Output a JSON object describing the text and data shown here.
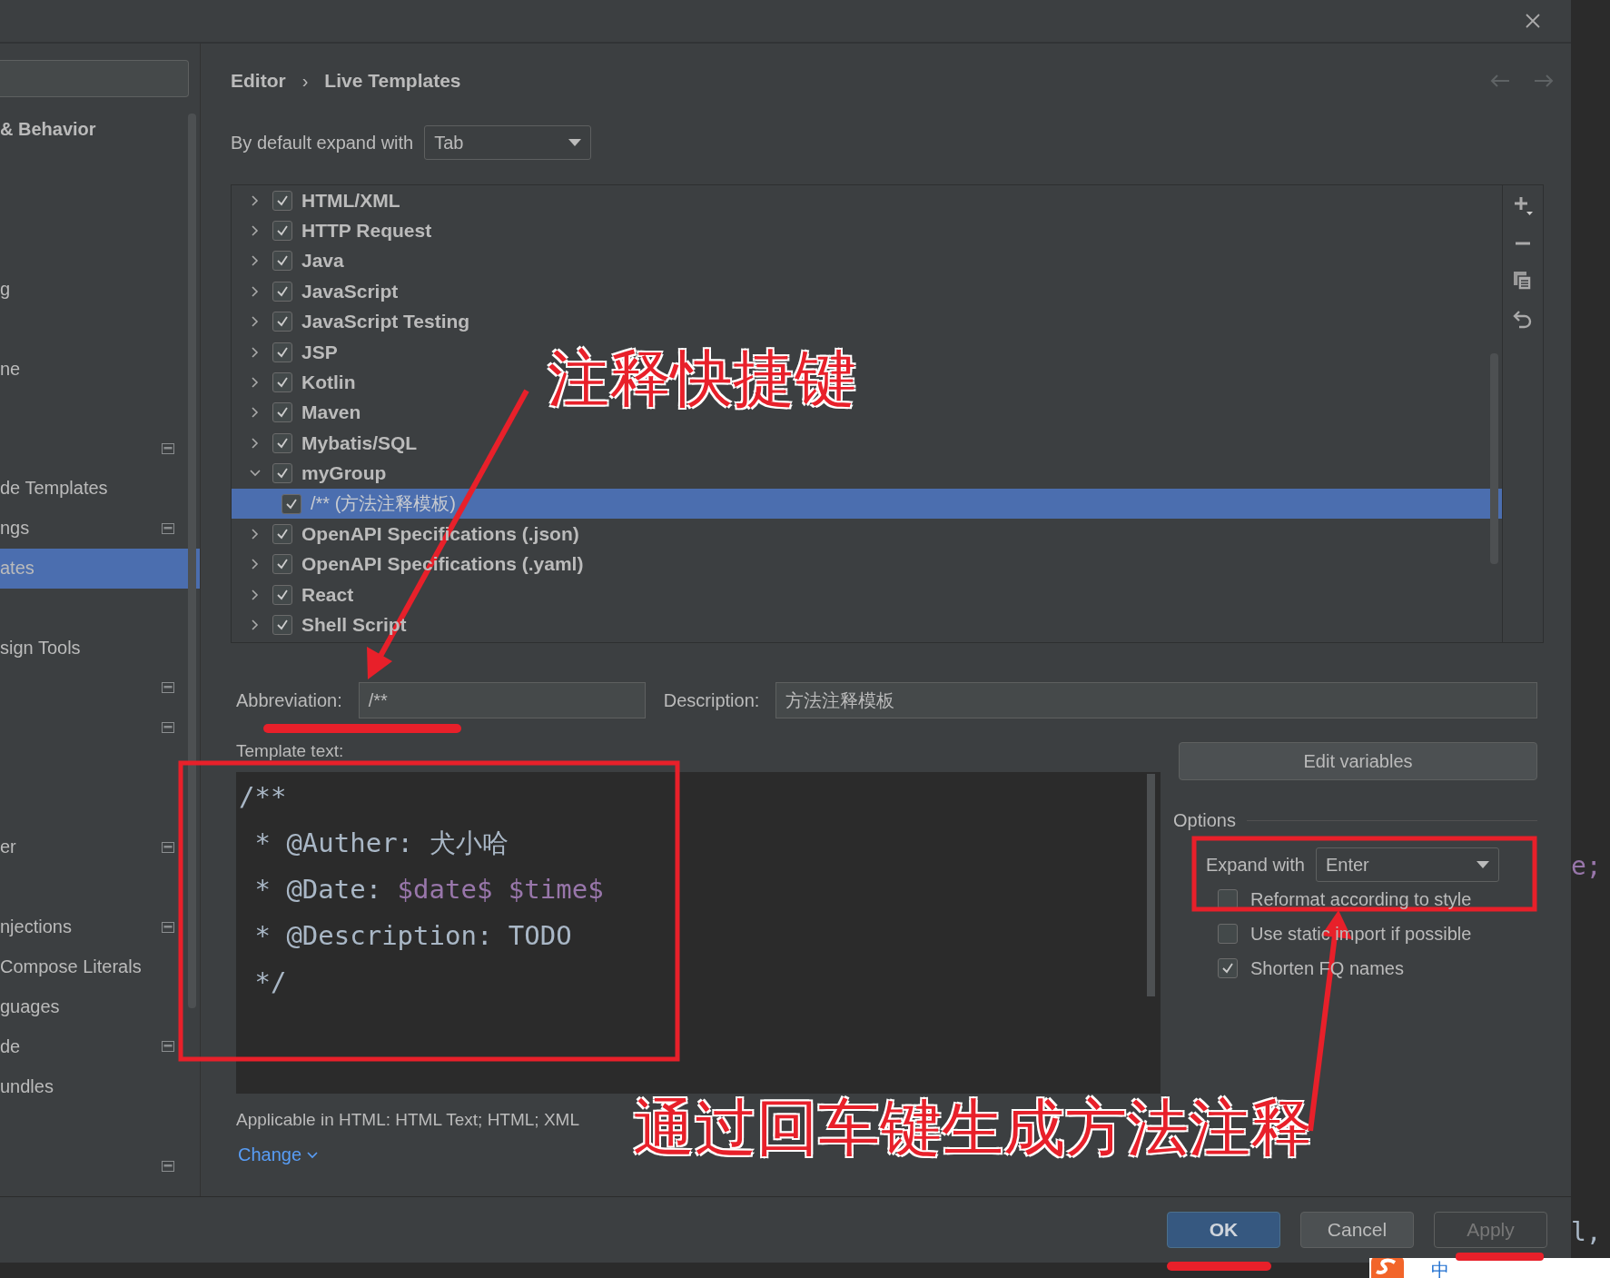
{
  "sidebar": {
    "items": [
      {
        "label": "& Behavior",
        "kind": "heading",
        "page_icon": false,
        "selected": false
      },
      {
        "kind": "blank"
      },
      {
        "kind": "blank"
      },
      {
        "kind": "blank"
      },
      {
        "label": "g",
        "kind": "item",
        "page_icon": false,
        "selected": false
      },
      {
        "kind": "blank"
      },
      {
        "label": "ne",
        "kind": "item",
        "page_icon": false,
        "selected": false
      },
      {
        "kind": "blank"
      },
      {
        "kind": "icon_only",
        "page_icon": true,
        "selected": false
      },
      {
        "label": "de Templates",
        "kind": "item",
        "page_icon": false,
        "selected": false
      },
      {
        "label": "ngs",
        "kind": "item",
        "page_icon": true,
        "selected": false
      },
      {
        "label": "ates",
        "kind": "item",
        "page_icon": false,
        "selected": true
      },
      {
        "kind": "blank"
      },
      {
        "label": "sign Tools",
        "kind": "item",
        "page_icon": false,
        "selected": false
      },
      {
        "kind": "icon_only",
        "page_icon": true,
        "selected": false
      },
      {
        "kind": "icon_only",
        "page_icon": true,
        "selected": false
      },
      {
        "kind": "blank"
      },
      {
        "kind": "blank"
      },
      {
        "label": "er",
        "kind": "item",
        "page_icon": true,
        "selected": false
      },
      {
        "kind": "blank"
      },
      {
        "label": "njections",
        "kind": "item",
        "page_icon": true,
        "selected": false
      },
      {
        "label": "Compose Literals",
        "kind": "item",
        "page_icon": false,
        "selected": false
      },
      {
        "label": "guages",
        "kind": "item",
        "page_icon": false,
        "selected": false
      },
      {
        "label": "de",
        "kind": "item",
        "page_icon": true,
        "selected": false
      },
      {
        "label": "undles",
        "kind": "item",
        "page_icon": false,
        "selected": false
      },
      {
        "kind": "blank"
      },
      {
        "kind": "icon_only",
        "page_icon": true,
        "selected": false
      }
    ]
  },
  "breadcrumb": {
    "items": [
      "Editor",
      "Live Templates"
    ],
    "separator": "›"
  },
  "default_expand": {
    "label": "By default expand with",
    "value": "Tab"
  },
  "tree": {
    "items": [
      {
        "label": "HTML/XML",
        "checked": true,
        "expanded": false,
        "selected": false
      },
      {
        "label": "HTTP Request",
        "checked": true,
        "expanded": false,
        "selected": false
      },
      {
        "label": "Java",
        "checked": true,
        "expanded": false,
        "selected": false
      },
      {
        "label": "JavaScript",
        "checked": true,
        "expanded": false,
        "selected": false
      },
      {
        "label": "JavaScript Testing",
        "checked": true,
        "expanded": false,
        "selected": false
      },
      {
        "label": "JSP",
        "checked": true,
        "expanded": false,
        "selected": false
      },
      {
        "label": "Kotlin",
        "checked": true,
        "expanded": false,
        "selected": false
      },
      {
        "label": "Maven",
        "checked": true,
        "expanded": false,
        "selected": false
      },
      {
        "label": "Mybatis/SQL",
        "checked": true,
        "expanded": false,
        "selected": false
      },
      {
        "label": "myGroup",
        "checked": true,
        "expanded": true,
        "selected": false,
        "children": [
          {
            "label": "/** (方法注释模板)",
            "checked": true,
            "selected": true
          }
        ]
      },
      {
        "label": "OpenAPI Specifications (.json)",
        "checked": true,
        "expanded": false,
        "selected": false
      },
      {
        "label": "OpenAPI Specifications (.yaml)",
        "checked": true,
        "expanded": false,
        "selected": false
      },
      {
        "label": "React",
        "checked": true,
        "expanded": false,
        "selected": false
      },
      {
        "label": "Shell Script",
        "checked": true,
        "expanded": false,
        "selected": false
      }
    ]
  },
  "abbreviation": {
    "label": "Abbreviation:",
    "value": "/**"
  },
  "description": {
    "label": "Description:",
    "value": "方法注释模板"
  },
  "template": {
    "label": "Template text:",
    "lines": [
      [
        {
          "text": "/**",
          "kind": "plain"
        }
      ],
      [
        {
          "text": " * @Auther: 犬小哈",
          "kind": "plain"
        }
      ],
      [
        {
          "text": " * @Date: ",
          "kind": "plain"
        },
        {
          "text": "$date$",
          "kind": "variable"
        },
        {
          "text": " $time$",
          "kind": "variable"
        }
      ],
      [
        {
          "text": " * @Description: TODO",
          "kind": "plain"
        }
      ],
      [
        {
          "text": " */",
          "kind": "plain"
        }
      ]
    ]
  },
  "edit_variables": "Edit variables",
  "options": {
    "title": "Options",
    "expand_with": {
      "label": "Expand with",
      "value": "Enter"
    },
    "checkboxes": [
      {
        "label": "Reformat according to style",
        "checked": false
      },
      {
        "label": "Use static import if possible",
        "checked": false
      },
      {
        "label": "Shorten FQ names",
        "checked": true
      }
    ]
  },
  "applicable": "Applicable in HTML: HTML Text; HTML; XML",
  "change_link": "Change",
  "buttons": [
    {
      "label": "OK",
      "kind": "primary"
    },
    {
      "label": "Cancel",
      "kind": "normal"
    },
    {
      "label": "Apply",
      "kind": "disabled"
    }
  ],
  "annotations": [
    {
      "text": "注释快捷键",
      "kind": "callout"
    },
    {
      "text": "通过回车键生成方法注释",
      "kind": "callout"
    }
  ],
  "editor_fragments": [
    "e;",
    "l,"
  ],
  "ime_toolbar": {
    "label": "中"
  }
}
